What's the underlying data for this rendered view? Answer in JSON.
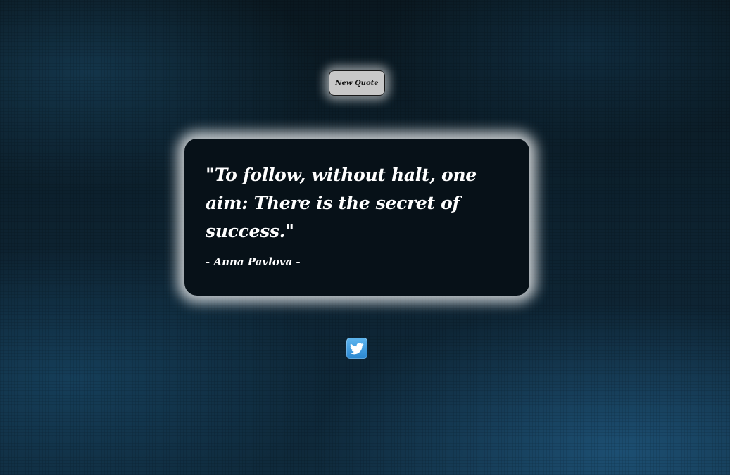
{
  "toolbar": {
    "new_quote_label": "New Quote"
  },
  "quote": {
    "text": "\"To follow, without halt, one aim: There is the secret of success.\"",
    "author": "- Anna Pavlova -"
  },
  "share": {
    "icon": "twitter-bird-icon",
    "color": "#2a86cf"
  }
}
